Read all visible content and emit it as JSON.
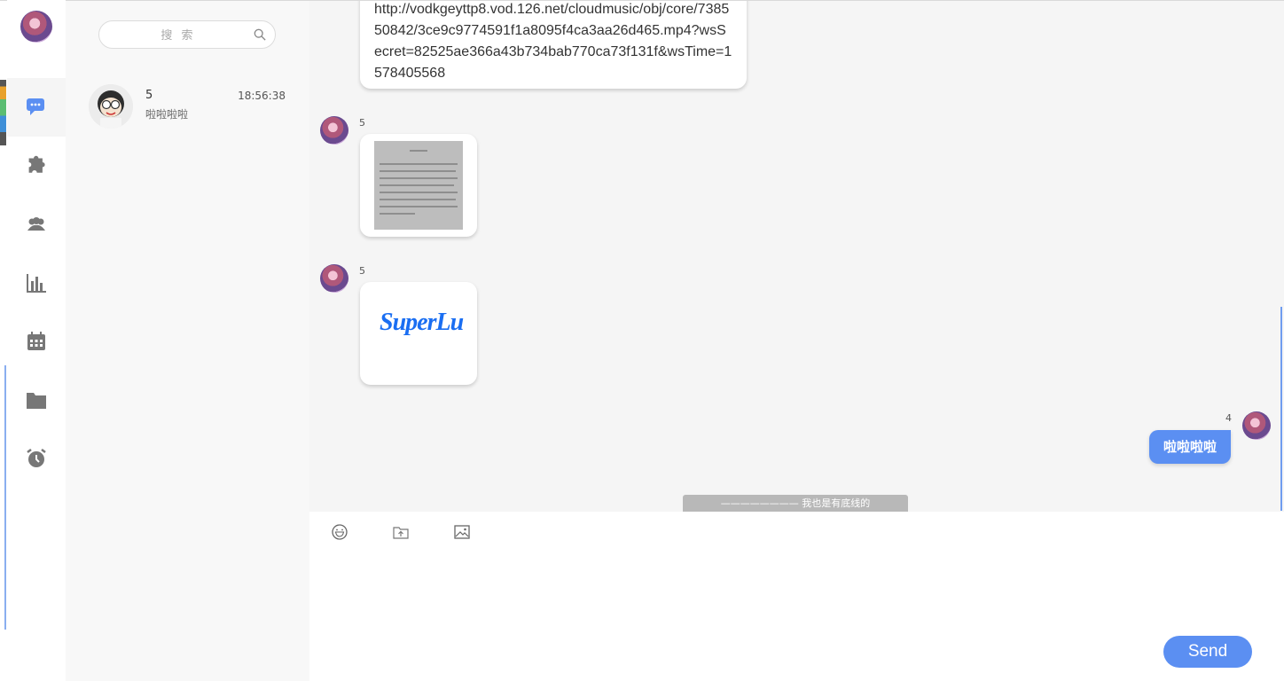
{
  "sidebar": {
    "nav_items": [
      "chat",
      "discover",
      "contacts",
      "statistics",
      "calendar",
      "files",
      "alarm"
    ],
    "accent_color": "#5b8ff2"
  },
  "chat_list": {
    "search_placeholder": "搜 索",
    "conversations": [
      {
        "name": "5",
        "time": "18:56:38",
        "preview": "啦啦啦啦"
      }
    ]
  },
  "messages": [
    {
      "sender": "",
      "type": "text",
      "text": "http://vodkgeyttp8.vod.126.net/cloudmusic/obj/core/738550842/3ce9c9774591f1a8095f4ca3aa26d465.mp4?wsSecret=82525ae366a43b734bab770ca73f131f&wsTime=1578405568"
    },
    {
      "sender": "5",
      "type": "image",
      "image": "document-photo"
    },
    {
      "sender": "5",
      "type": "image",
      "image": "superlu-logo",
      "logo_text": "SuperLu"
    },
    {
      "sender": "4",
      "type": "text",
      "text": "啦啦啦啦",
      "mine": true
    }
  ],
  "bottom_notice": "———————— 我也是有底线的 ————————",
  "composer": {
    "tools": [
      "emoji-icon",
      "file-upload-icon",
      "image-icon"
    ],
    "send_label": "Send"
  }
}
